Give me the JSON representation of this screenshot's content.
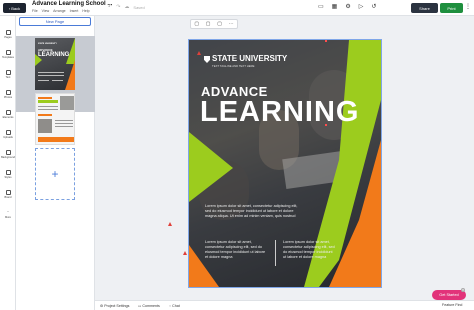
{
  "topbar": {
    "back_label": "Back",
    "doc_title": "Advance Learning School ...",
    "menus": [
      "File",
      "View",
      "Arrange",
      "Insert",
      "Help"
    ],
    "status": "Saved",
    "share_label": "Share",
    "print_label": "Print",
    "more_glyph": "⋮"
  },
  "rail": {
    "items": [
      "Pages",
      "Templates",
      "Text",
      "Photos",
      "Elements",
      "Uploads",
      "Background",
      "Styles",
      "Brand",
      "More"
    ]
  },
  "pages_panel": {
    "new_page_label": "New Page",
    "add_glyph": "+"
  },
  "page_tools": [
    "▢",
    "▢",
    "▢",
    "⋯"
  ],
  "flyer": {
    "brand": "STATE UNIVERSITY",
    "brand_tagline": "TEXT TAGLINE AND TEXT HERE",
    "headline_small": "ADVANCE",
    "headline_big": "LEARNING",
    "para1": "Lorem ipsum dolor sit amet, consectetur adipiscing elit, sed do eiusmod tempor incididunt ut labore et dolore magna aliqua. Ut enim ad minim veniam, quis nostrud",
    "col_left": "Lorem ipsum dolor sit amet, consectetur adipiscing elit, sed do eiusmod tempor incididunt ut labore et dolore magna",
    "col_right": "Lorem ipsum dolor sit amet, consectetur adipiscing elit, sed do eiusmod tempor incididunt ut labore et dolore magna"
  },
  "bottombar": {
    "settings_label": "Project Settings",
    "comments_label": "Comments",
    "chat_label": "Chat",
    "feature_label": "Feature Find"
  },
  "getstarted": {
    "label": "Get Started",
    "close_glyph": "×"
  },
  "colors": {
    "accent_green": "#9ccc1e",
    "accent_orange": "#f27a1a",
    "print_green": "#1e8f3e",
    "pink": "#e2337a"
  }
}
